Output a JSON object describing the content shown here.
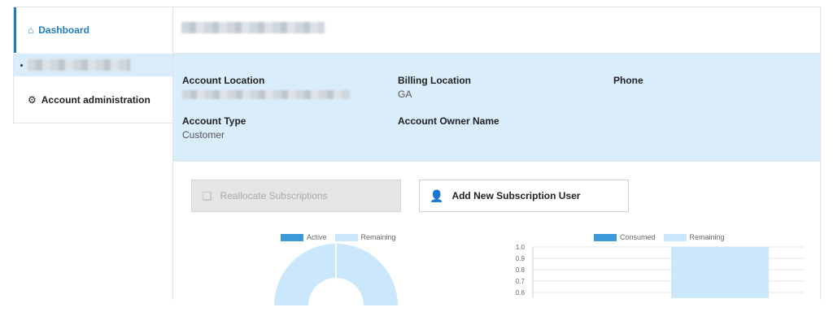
{
  "sidebar": {
    "dashboard_label": "Dashboard",
    "admin_label": "Account administration"
  },
  "info": {
    "account_location_label": "Account Location",
    "billing_location_label": "Billing Location",
    "billing_location_value": "GA",
    "phone_label": "Phone",
    "account_type_label": "Account Type",
    "account_type_value": "Customer",
    "account_owner_label": "Account Owner Name"
  },
  "actions": {
    "reallocate_label": "Reallocate Subscriptions",
    "add_user_label": "Add New Subscription User"
  },
  "colors": {
    "accent": "#1f7dc1",
    "active": "#3a9ad9",
    "remaining": "#cbe7fb",
    "panel": "#daedfb"
  },
  "chart_data": [
    {
      "type": "pie",
      "legend": [
        "Active",
        "Remaining"
      ]
    },
    {
      "type": "bar",
      "legend": [
        "Consumed",
        "Remaining"
      ],
      "ylim": [
        0,
        1.0
      ],
      "yticks": [
        "1.0",
        "0.9",
        "0.8",
        "0.7",
        "0.6"
      ],
      "series": [
        {
          "name": "Remaining",
          "values": [
            1.0
          ]
        }
      ]
    }
  ]
}
